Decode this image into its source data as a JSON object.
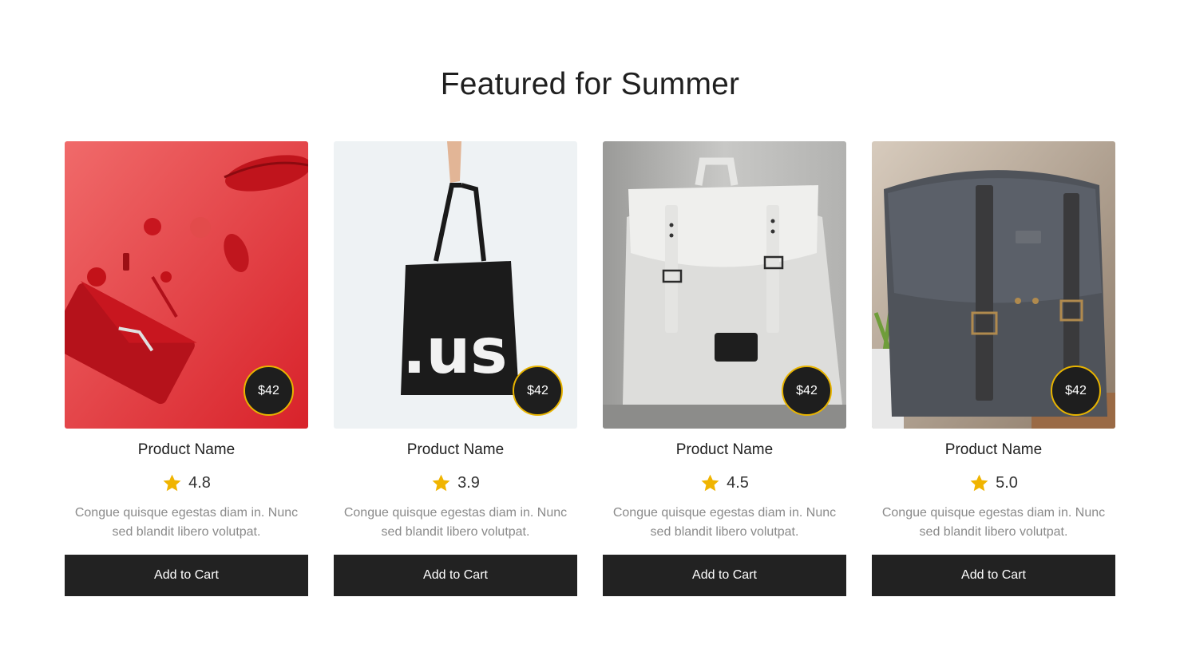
{
  "section": {
    "title": "Featured for Summer"
  },
  "colors": {
    "accent": "#e8b400",
    "button_bg": "#222222",
    "star": "#f0b400"
  },
  "products": [
    {
      "name": "Product Name",
      "price": "$42",
      "rating": "4.8",
      "description": "Congue quisque egestas diam in. Nunc sed blandit libero volutpat.",
      "button": "Add to Cart",
      "image": "red-clutch-and-cosmetics-photo"
    },
    {
      "name": "Product Name",
      "price": "$42",
      "rating": "3.9",
      "description": "Congue quisque egestas diam in. Nunc sed blandit libero volutpat.",
      "button": "Add to Cart",
      "image": "black-tote-bag-photo"
    },
    {
      "name": "Product Name",
      "price": "$42",
      "rating": "4.5",
      "description": "Congue quisque egestas diam in. Nunc sed blandit libero volutpat.",
      "button": "Add to Cart",
      "image": "white-backpack-photo"
    },
    {
      "name": "Product Name",
      "price": "$42",
      "rating": "5.0",
      "description": "Congue quisque egestas diam in. Nunc sed blandit libero volutpat.",
      "button": "Add to Cart",
      "image": "grey-canvas-messenger-bag-photo"
    }
  ]
}
